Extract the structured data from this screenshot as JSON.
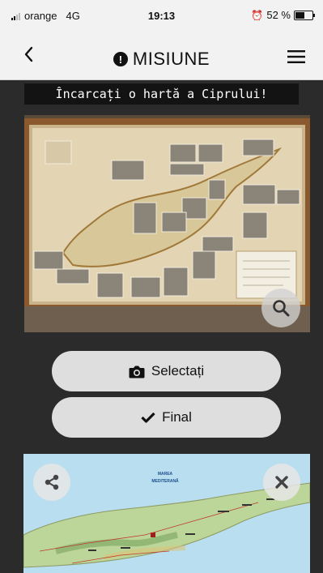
{
  "status_bar": {
    "carrier": "orange",
    "network": "4G",
    "time": "19:13",
    "battery": "52 %"
  },
  "nav": {
    "title": "MISIUNE",
    "back_icon": "chevron-left-icon",
    "menu_icon": "hamburger-menu-icon",
    "info_icon": "exclamation-circle-icon"
  },
  "instruction": "Încarcați o hartă a Ciprului!",
  "photo": {
    "zoom_icon": "search-icon"
  },
  "buttons": {
    "select_label": "Selectați",
    "select_icon": "camera-icon",
    "finish_label": "Final",
    "finish_icon": "check-icon"
  },
  "map": {
    "sea_label_1": "MAREA",
    "sea_label_2": "MEDITERANĂ",
    "share_icon": "share-icon",
    "close_icon": "close-icon"
  },
  "colors": {
    "background": "#2b2b2b",
    "header": "#f2f2f2",
    "button": "#dedede",
    "banner": "#131313"
  }
}
